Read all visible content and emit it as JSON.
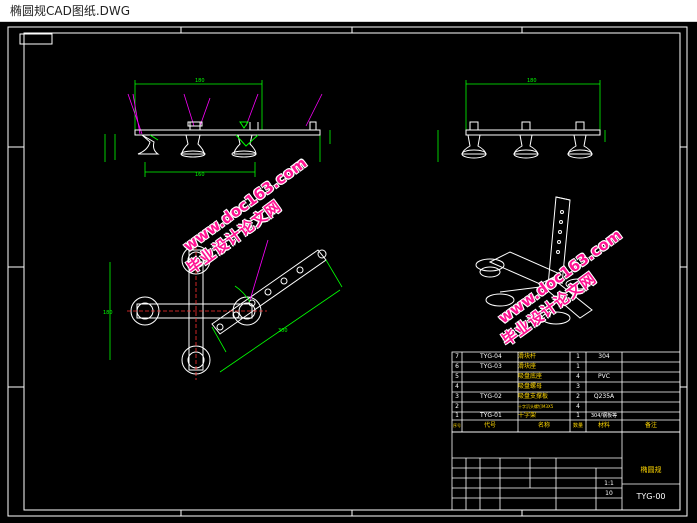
{
  "window": {
    "title": "椭圆规CAD图纸.DWG"
  },
  "colors": {
    "background": "#000000",
    "frame": "#ffffff",
    "drawing": "#ffffff",
    "dimension": "#00ff00",
    "leader": "#ff00ff",
    "title_block_red": "#ff3030",
    "watermark": "#ff1493"
  },
  "watermarks": [
    {
      "line1": "www.doc163.com",
      "line2": "毕业设计论文网"
    },
    {
      "line1": "www.doc163.com",
      "line2": "毕业设计论文网"
    }
  ],
  "bom": {
    "rows": [
      {
        "seq": "7",
        "code": "TYG-04",
        "name": "滑块杆",
        "qty": "1",
        "material": "304"
      },
      {
        "seq": "6",
        "code": "TYG-03",
        "name": "滑块座",
        "qty": "1",
        "material": ""
      },
      {
        "seq": "5",
        "code": "",
        "name": "吸盘底座",
        "qty": "4",
        "material": "PVC"
      },
      {
        "seq": "4",
        "code": "",
        "name": "吸盘螺母",
        "qty": "3",
        "material": ""
      },
      {
        "seq": "3",
        "code": "TYG-02",
        "name": "吸盘支撑板",
        "qty": "2",
        "material": "Q235A"
      },
      {
        "seq": "2",
        "code": "",
        "name": "十字沉头螺钉M3X5",
        "qty": "4",
        "material": ""
      },
      {
        "seq": "1",
        "code": "TYG-01",
        "name": "十字架",
        "qty": "1",
        "material": "304/钢板等"
      }
    ],
    "header": {
      "seq": "序号",
      "code": "代号",
      "name": "名称",
      "qty": "数量",
      "material": "材料",
      "note": "备注"
    }
  },
  "title_block": {
    "drawing_name": "椭圆规",
    "drawing_number": "TYG-00",
    "scale": "1:1",
    "sheet": "10"
  }
}
